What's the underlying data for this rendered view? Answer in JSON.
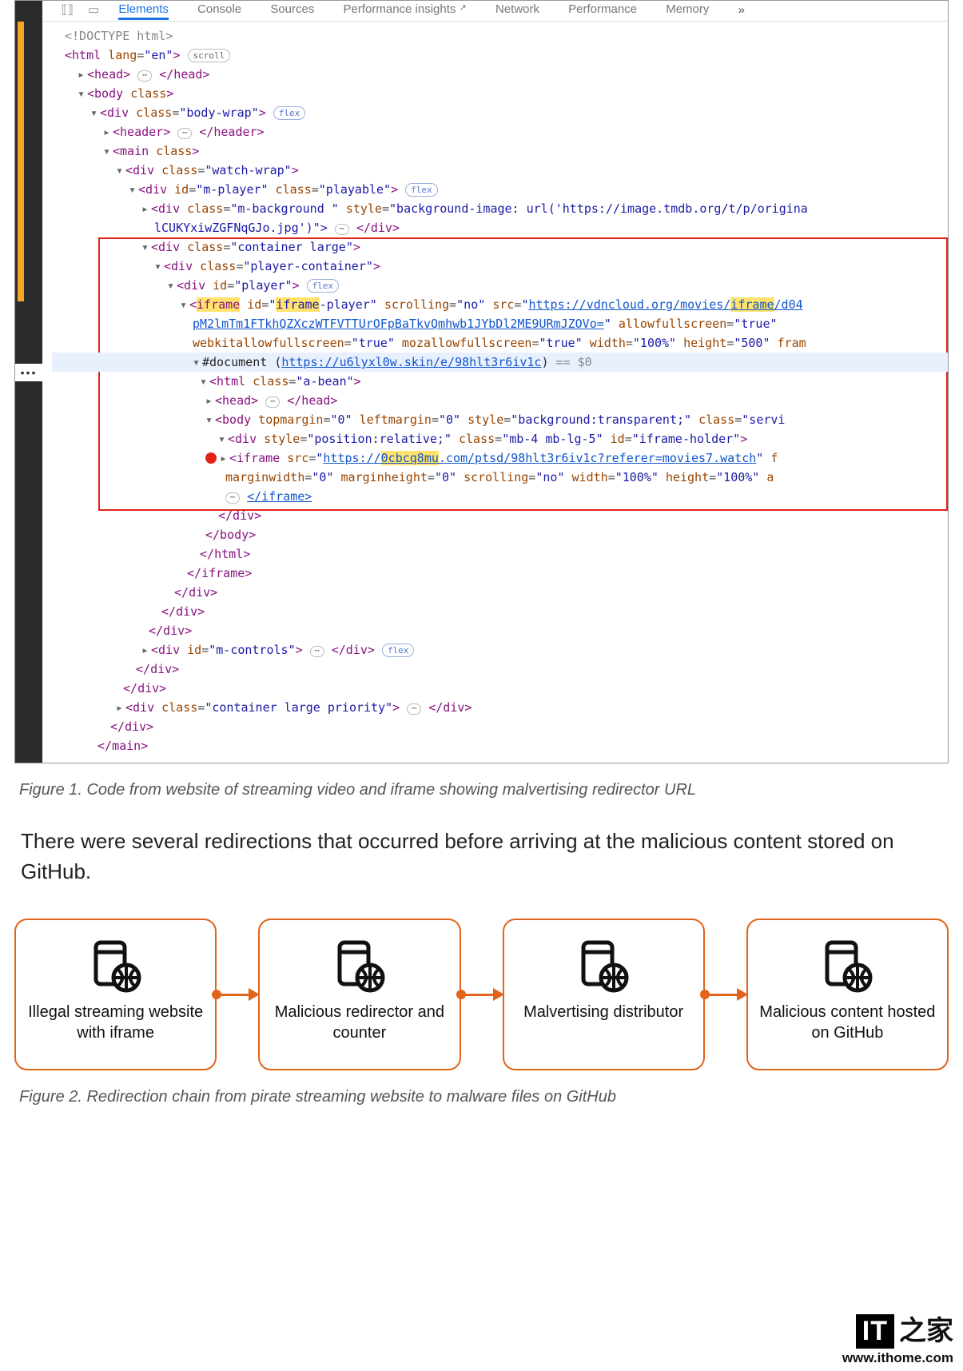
{
  "devtools": {
    "tabs": [
      "Elements",
      "Console",
      "Sources",
      "Performance insights",
      "Network",
      "Performance",
      "Memory"
    ],
    "active_tab_index": 0,
    "more": "»",
    "dots": "•••",
    "pill_scroll": "scroll",
    "pill_flex": "flex",
    "doc_eq": "== $0",
    "lines": {
      "doctype": "<!DOCTYPE html>",
      "html_open": {
        "tag": "html",
        "attrs": [
          [
            "lang",
            "en"
          ]
        ]
      },
      "head": {
        "tag": "head"
      },
      "body_open": {
        "tag": "body",
        "attr_name": "class"
      },
      "body_wrap": {
        "tag": "div",
        "attrs": [
          [
            "class",
            "body-wrap"
          ]
        ]
      },
      "header": {
        "tag": "header"
      },
      "main": {
        "tag": "main",
        "attr_name": "class"
      },
      "watch_wrap": {
        "tag": "div",
        "attrs": [
          [
            "class",
            "watch-wrap"
          ]
        ]
      },
      "m_player": {
        "tag": "div",
        "attrs": [
          [
            "id",
            "m-player"
          ],
          [
            "class",
            "playable"
          ]
        ]
      },
      "m_bg": {
        "tag": "div",
        "attrs": [
          [
            "class",
            "m-background "
          ],
          [
            "style",
            "background-image: url('https://image.tmdb.org/t/p/origina"
          ]
        ],
        "tail": "lCUKYxiwZGFNqGJo.jpg')\">"
      },
      "container_large": {
        "tag": "div",
        "attrs": [
          [
            "class",
            "container large"
          ]
        ]
      },
      "player_container": {
        "tag": "div",
        "attrs": [
          [
            "class",
            "player-container"
          ]
        ]
      },
      "player": {
        "tag": "div",
        "attrs": [
          [
            "id",
            "player"
          ]
        ]
      },
      "iframe1_pre": "<",
      "iframe1_tag": "iframe",
      "iframe1_attrs": [
        [
          "id",
          "iframe-player"
        ],
        [
          "scrolling",
          "no"
        ]
      ],
      "iframe1_src_label": "src",
      "iframe1_src_pre": "https://vdncloud.org/movies/",
      "iframe1_src_hl": "iframe",
      "iframe1_src_post": "/d04",
      "iframe1_line2": "pM2lmTm1FTkhQZXczWTFVTTUrOFpBaTkvQmhwb1JYbDl2ME9URmJZOVo=",
      "iframe1_line2_attrs": [
        [
          "allowfullscreen",
          "true"
        ]
      ],
      "iframe1_line3_attrs": [
        [
          "webkitallowfullscreen",
          "true"
        ],
        [
          "mozallowfullscreen",
          "true"
        ],
        [
          "width",
          "100%"
        ],
        [
          "height",
          "500"
        ]
      ],
      "iframe1_line3_tail": "fram",
      "shadow_doc_label": "#document",
      "shadow_doc_url": "https://u6lyxl0w.skin/e/98hlt3r6iv1c",
      "html2": {
        "tag": "html",
        "attrs": [
          [
            "class",
            "a-bean"
          ]
        ]
      },
      "head2": {
        "tag": "head"
      },
      "body2": {
        "tag": "body",
        "attrs": [
          [
            "topmargin",
            "0"
          ],
          [
            "leftmargin",
            "0"
          ],
          [
            "style",
            "background:transparent;"
          ],
          [
            "class",
            "servi"
          ]
        ]
      },
      "holder": {
        "tag": "div",
        "attrs": [
          [
            "style",
            "position:relative;"
          ],
          [
            "class",
            "mb-4 mb-lg-5"
          ],
          [
            "id",
            "iframe-holder"
          ]
        ]
      },
      "iframe2_tag": "iframe",
      "iframe2_src_label": "src",
      "iframe2_src_pre": "https://",
      "iframe2_src_hl": "0cbcq8mu",
      "iframe2_src_post": ".com/ptsd/98hlt3r6iv1c?referer=movies7.watch",
      "iframe2_tail": "f",
      "iframe2_line2_attrs": [
        [
          "marginwidth",
          "0"
        ],
        [
          "marginheight",
          "0"
        ],
        [
          "scrolling",
          "no"
        ],
        [
          "width",
          "100%"
        ],
        [
          "height",
          "100%"
        ]
      ],
      "iframe2_line2_tail": "a",
      "close_iframe": "</iframe>",
      "close_div": "</div>",
      "close_body": "</body>",
      "close_html": "</html>",
      "m_controls": {
        "tag": "div",
        "attrs": [
          [
            "id",
            "m-controls"
          ]
        ]
      },
      "container_lp": {
        "tag": "div",
        "attrs": [
          [
            "class",
            "container large priority"
          ]
        ]
      },
      "close_main": "</main>"
    }
  },
  "figure1_caption": "Figure 1. Code from website of streaming video and iframe showing malvertising redirector URL",
  "body_paragraph": "There were several redirections that occurred before arriving at the malicious content stored on GitHub.",
  "diagram": {
    "nodes": [
      "Illegal streaming website with iframe",
      "Malicious redirector and counter",
      "Malvertising distributor",
      "Malicious content hosted on GitHub"
    ]
  },
  "figure2_caption": "Figure 2. Redirection chain from pirate streaming website to malware files on GitHub",
  "watermark": {
    "badge": "IT",
    "zh": "之家",
    "url": "www.ithome.com"
  }
}
